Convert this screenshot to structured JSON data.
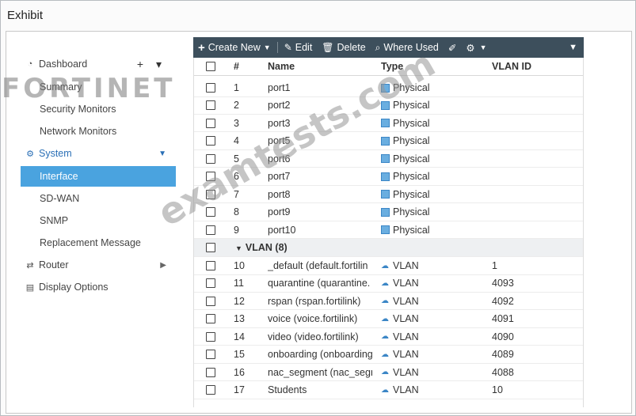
{
  "exhibit_title": "Exhibit",
  "logo_text": "FORTINET",
  "watermark": "examtests.com",
  "sidebar": {
    "dashboard": "Dashboard",
    "dashboard_tools": "+ ▾",
    "summary": "Summary",
    "security_monitors": "Security Monitors",
    "network_monitors": "Network Monitors",
    "system": "System",
    "interface": "Interface",
    "sdwan": "SD-WAN",
    "snmp": "SNMP",
    "replacement_message": "Replacement Message",
    "router": "Router",
    "display_options": "Display Options"
  },
  "toolbar": {
    "create_new": "Create New",
    "edit": "Edit",
    "delete": "Delete",
    "where_used": "Where Used"
  },
  "table": {
    "headers": {
      "num": "#",
      "name": "Name",
      "type": "Type",
      "vlan_id": "VLAN ID"
    },
    "physical_rows": [
      {
        "num": "1",
        "name": "port1",
        "type": "Physical",
        "vlan_id": ""
      },
      {
        "num": "2",
        "name": "port2",
        "type": "Physical",
        "vlan_id": ""
      },
      {
        "num": "3",
        "name": "port3",
        "type": "Physical",
        "vlan_id": ""
      },
      {
        "num": "4",
        "name": "port5",
        "type": "Physical",
        "vlan_id": ""
      },
      {
        "num": "5",
        "name": "port6",
        "type": "Physical",
        "vlan_id": ""
      },
      {
        "num": "6",
        "name": "port7",
        "type": "Physical",
        "vlan_id": ""
      },
      {
        "num": "7",
        "name": "port8",
        "type": "Physical",
        "vlan_id": ""
      },
      {
        "num": "8",
        "name": "port9",
        "type": "Physical",
        "vlan_id": ""
      },
      {
        "num": "9",
        "name": "port10",
        "type": "Physical",
        "vlan_id": ""
      }
    ],
    "vlan_group_label": "VLAN (8)",
    "vlan_rows": [
      {
        "num": "10",
        "name": "_default (default.fortilin",
        "type": "VLAN",
        "vlan_id": "1"
      },
      {
        "num": "11",
        "name": "quarantine (quarantine.",
        "type": "VLAN",
        "vlan_id": "4093"
      },
      {
        "num": "12",
        "name": "rspan (rspan.fortilink)",
        "type": "VLAN",
        "vlan_id": "4092"
      },
      {
        "num": "13",
        "name": "voice (voice.fortilink)",
        "type": "VLAN",
        "vlan_id": "4091"
      },
      {
        "num": "14",
        "name": "video (video.fortilink)",
        "type": "VLAN",
        "vlan_id": "4090"
      },
      {
        "num": "15",
        "name": "onboarding (onboarding",
        "type": "VLAN",
        "vlan_id": "4089"
      },
      {
        "num": "16",
        "name": "nac_segment (nac_segr",
        "type": "VLAN",
        "vlan_id": "4088"
      },
      {
        "num": "17",
        "name": "Students",
        "type": "VLAN",
        "vlan_id": "10"
      }
    ]
  },
  "colors": {
    "toolbar_bg": "#3d4f5c",
    "active_nav": "#4aa3df",
    "section_blue": "#2a6fb6"
  }
}
